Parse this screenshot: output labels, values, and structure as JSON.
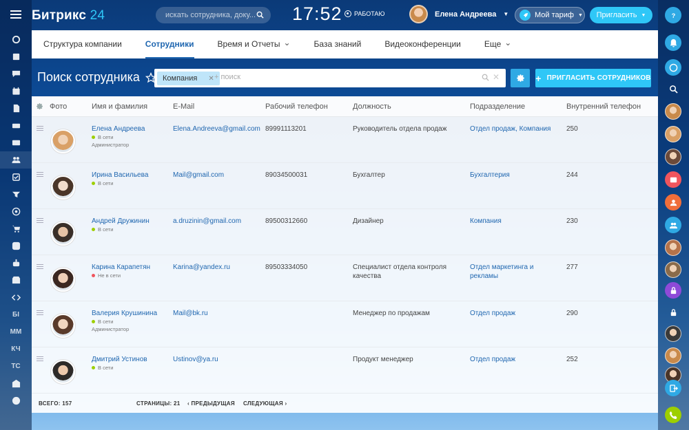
{
  "header": {
    "logo_main": "Битрикс",
    "logo_num": "24",
    "search_placeholder": "искать сотрудника, доку...",
    "clock": "17:52",
    "work_status": "РАБОТАЮ",
    "user_name": "Елена Андреева",
    "tariff_label": "Мой тариф",
    "invite_label": "Пригласить"
  },
  "tabs": [
    {
      "label": "Структура компании",
      "active": false,
      "dropdown": false
    },
    {
      "label": "Сотрудники",
      "active": true,
      "dropdown": false
    },
    {
      "label": "Время и Отчеты",
      "active": false,
      "dropdown": true
    },
    {
      "label": "База знаний",
      "active": false,
      "dropdown": false
    },
    {
      "label": "Видеоконференции",
      "active": false,
      "dropdown": false
    },
    {
      "label": "Еще",
      "active": false,
      "dropdown": true
    }
  ],
  "page": {
    "title": "Поиск сотрудника",
    "filter_chip": "Компания",
    "filter_placeholder": "+ поиск",
    "invite_employees": "ПРИГЛАСИТЬ СОТРУДНИКОВ"
  },
  "table": {
    "columns": [
      "Фото",
      "Имя и фамилия",
      "E-Mail",
      "Рабочий телефон",
      "Должность",
      "Подразделение",
      "Внутренний телефон"
    ],
    "rows": [
      {
        "name": "Елена Андреева",
        "status": "В сети",
        "online": true,
        "role": "Администратор",
        "email": "Elena.Andreeva@gmail.com",
        "phone": "89991113201",
        "position": "Руководитель отдела продаж",
        "dept": "Отдел продаж, Компания",
        "ext": "250"
      },
      {
        "name": "Ирина Васильева",
        "status": "В сети",
        "online": true,
        "role": "",
        "email": "Mail@gmail.com",
        "phone": "89034500031",
        "position": "Бухгалтер",
        "dept": "Бухгалтерия",
        "ext": "244"
      },
      {
        "name": "Андрей Дружинин",
        "status": "В сети",
        "online": true,
        "role": "",
        "email": "a.druzinin@gmail.com",
        "phone": "89500312660",
        "position": "Дизайнер",
        "dept": "Компания",
        "ext": "230"
      },
      {
        "name": "Карина Карапетян",
        "status": "Не в сети",
        "online": false,
        "role": "",
        "email": "Karina@yandex.ru",
        "phone": "89503334050",
        "position": "Специалист отдела контроля качества",
        "dept": "Отдел маркетинга и рекламы",
        "ext": "277"
      },
      {
        "name": "Валерия Крушинина",
        "status": "В сети",
        "online": true,
        "role": "Администратор",
        "email": "Mail@bk.ru",
        "phone": "",
        "position": "Менеджер по продажам",
        "dept": "Отдел продаж",
        "ext": "290"
      },
      {
        "name": "Дмитрий Устинов",
        "status": "В сети",
        "online": true,
        "role": "",
        "email": "Ustinov@ya.ru",
        "phone": "",
        "position": "Продукт менеджер",
        "dept": "Отдел продаж",
        "ext": "252"
      }
    ]
  },
  "footer": {
    "total_label": "ВСЕГО:",
    "total": "157",
    "pages_label": "СТРАНИЦЫ:",
    "pages": "21",
    "prev": "ПРЕДЫДУЩАЯ",
    "next": "СЛЕДУЮЩАЯ"
  },
  "left_nav": [
    {
      "icon": "stream-icon"
    },
    {
      "icon": "news-icon"
    },
    {
      "icon": "chat-icon"
    },
    {
      "icon": "calendar-icon"
    },
    {
      "icon": "document-icon"
    },
    {
      "icon": "drive-icon"
    },
    {
      "icon": "mail-icon"
    },
    {
      "icon": "employees-icon",
      "active": true
    },
    {
      "icon": "tasks-icon"
    },
    {
      "icon": "crm-filter-icon"
    },
    {
      "icon": "target-icon"
    },
    {
      "icon": "cart-icon"
    },
    {
      "icon": "contact-center-icon"
    },
    {
      "icon": "robot-icon"
    },
    {
      "icon": "store-icon"
    },
    {
      "icon": "code-icon"
    },
    {
      "text": "БI"
    },
    {
      "text": "ММ"
    },
    {
      "text": "КЧ"
    },
    {
      "text": "ТС"
    },
    {
      "icon": "company-icon"
    },
    {
      "icon": "more-icon"
    }
  ],
  "colors": {
    "accent": "#2fc7f7",
    "link": "#2067b0",
    "online": "#9dcf00",
    "offline": "#f0555d"
  }
}
